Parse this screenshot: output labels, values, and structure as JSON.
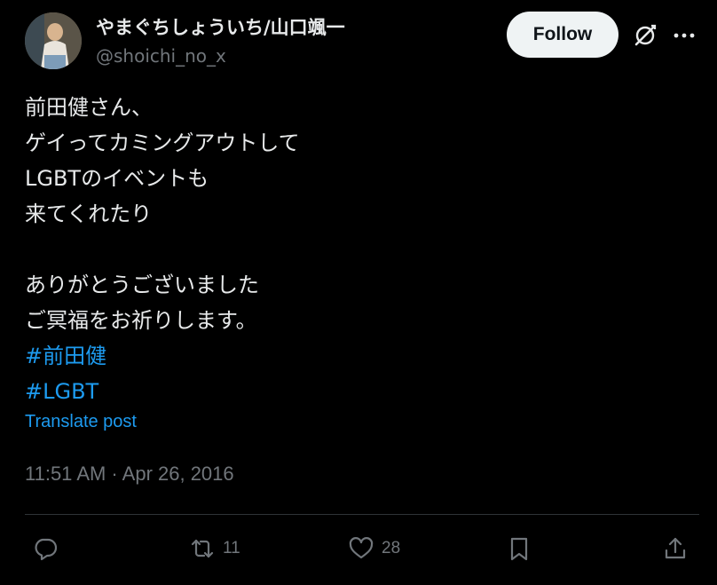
{
  "author": {
    "name": "やまぐちしょういち/山口颯一",
    "handle": "@shoichi_no_x"
  },
  "header": {
    "follow_label": "Follow"
  },
  "post": {
    "lines": [
      "前田健さん、",
      "ゲイってカミングアウトして",
      "LGBTのイベントも",
      "来てくれたり",
      "",
      "ありがとうございました",
      "ご冥福をお祈りします。"
    ],
    "hashtags": [
      "#前田健",
      "#LGBT"
    ],
    "translate_label": "Translate post",
    "timestamp": "11:51 AM · Apr 26, 2016"
  },
  "actions": {
    "retweet_count": "11",
    "like_count": "28"
  },
  "colors": {
    "background": "#000000",
    "text": "#e7e9ea",
    "muted": "#71767b",
    "link": "#1d9bf0",
    "follow_bg": "#eff3f4"
  },
  "icons": [
    "grok-icon",
    "more-icon",
    "reply-icon",
    "retweet-icon",
    "like-icon",
    "bookmark-icon",
    "share-icon"
  ]
}
